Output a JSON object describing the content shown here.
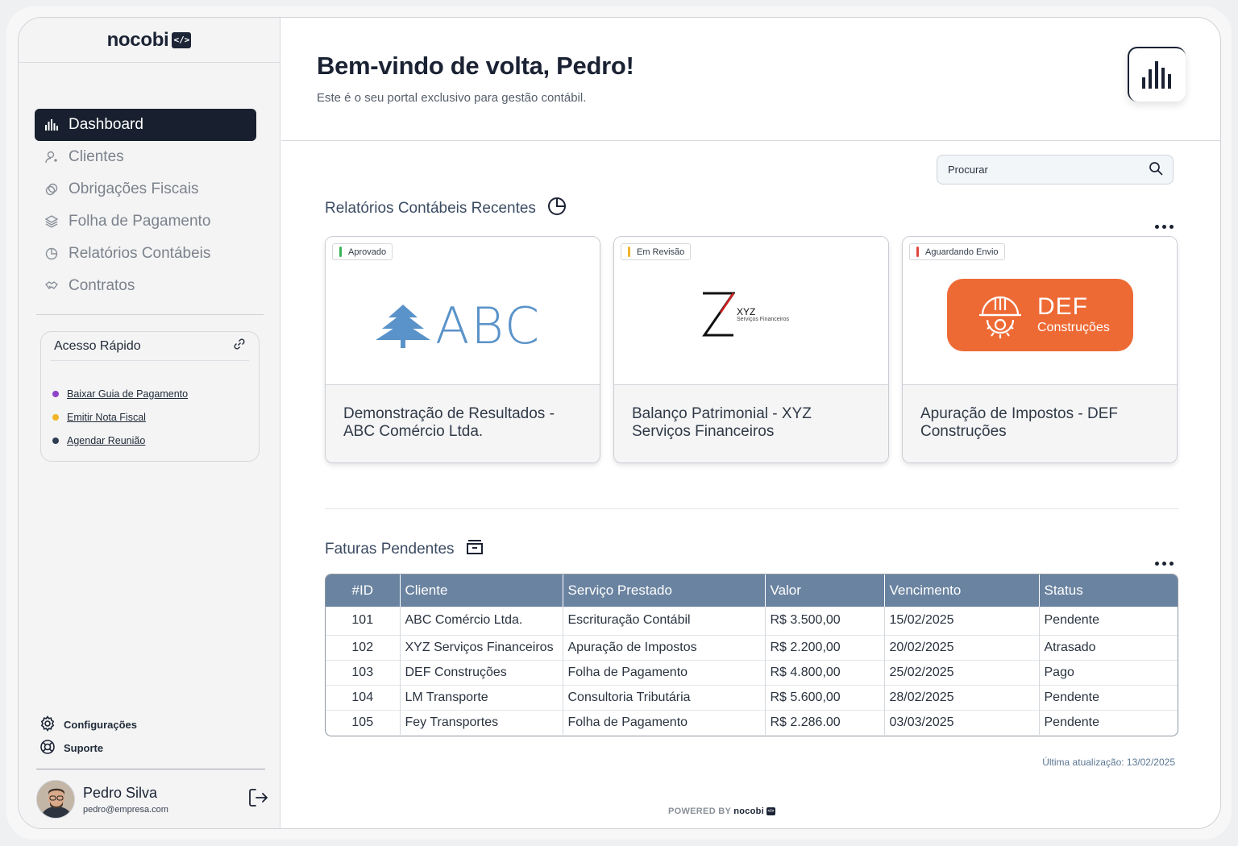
{
  "brand": {
    "name": "nocobi",
    "badge": "</>"
  },
  "sidebar": {
    "items": [
      {
        "label": "Dashboard",
        "icon": "bar-chart-icon",
        "active": true
      },
      {
        "label": "Clientes",
        "icon": "user-icon"
      },
      {
        "label": "Obrigações Fiscais",
        "icon": "coins-icon"
      },
      {
        "label": "Folha de Pagamento",
        "icon": "layers-icon"
      },
      {
        "label": "Relatórios Contábeis",
        "icon": "pie-chart-icon"
      },
      {
        "label": "Contratos",
        "icon": "handshake-icon"
      }
    ],
    "quick_access": {
      "title": "Acesso Rápido",
      "links": [
        {
          "label": "Baixar Guia de Pagamento",
          "color": "#8e44c9"
        },
        {
          "label": "Emitir Nota Fiscal",
          "color": "#f0b429"
        },
        {
          "label": "Agendar Reunião",
          "color": "#2f3e52"
        }
      ]
    },
    "settings_label": "Configurações",
    "support_label": "Suporte",
    "user": {
      "name": "Pedro Silva",
      "email": "pedro@empresa.com"
    }
  },
  "header": {
    "title": "Bem-vindo de volta, Pedro!",
    "subtitle": "Este é o seu portal exclusivo para gestão contábil."
  },
  "search": {
    "placeholder": "Procurar"
  },
  "reports": {
    "title": "Relatórios Contábeis Recentes",
    "cards": [
      {
        "status": "Aprovado",
        "status_color": "#3cb45a",
        "logo_text": "ABC",
        "title": "Demonstração de Resultados - ABC Comércio Ltda."
      },
      {
        "status": "Em Revisão",
        "status_color": "#f0b429",
        "logo_text": "XYZ",
        "logo_sub": "Serviços Financeiros",
        "title": "Balanço Patrimonial - XYZ Serviços Financeiros"
      },
      {
        "status": "Aguardando Envio",
        "status_color": "#e0463c",
        "logo_text": "DEF",
        "logo_sub": "Construções",
        "title": "Apuração de Impostos - DEF Construções"
      }
    ]
  },
  "invoices": {
    "title": "Faturas Pendentes",
    "columns": [
      "#ID",
      "Cliente",
      "Serviço Prestado",
      "Valor",
      "Vencimento",
      "Status"
    ],
    "rows": [
      [
        "101",
        "ABC Comércio Ltda.",
        "Escrituração Contábil",
        "R$ 3.500,00",
        "15/02/2025",
        "Pendente"
      ],
      [
        "102",
        "XYZ Serviços Financeiros",
        "Apuração de Impostos",
        "R$ 2.200,00",
        "20/02/2025",
        "Atrasado"
      ],
      [
        "103",
        "DEF Construções",
        "Folha de Pagamento",
        "R$ 4.800,00",
        "25/02/2025",
        "Pago"
      ],
      [
        "104",
        "LM Transporte",
        "Consultoria Tributária",
        "R$ 5.600,00",
        "28/02/2025",
        "Pendente"
      ],
      [
        "105",
        "Fey Transportes",
        "Folha de Pagamento",
        "R$ 2.286.00",
        "03/03/2025",
        "Pendente"
      ]
    ]
  },
  "footer": {
    "updated": "Última atualização: 13/02/2025",
    "powered_prefix": "POWERED BY",
    "powered_brand": "nocobi"
  }
}
